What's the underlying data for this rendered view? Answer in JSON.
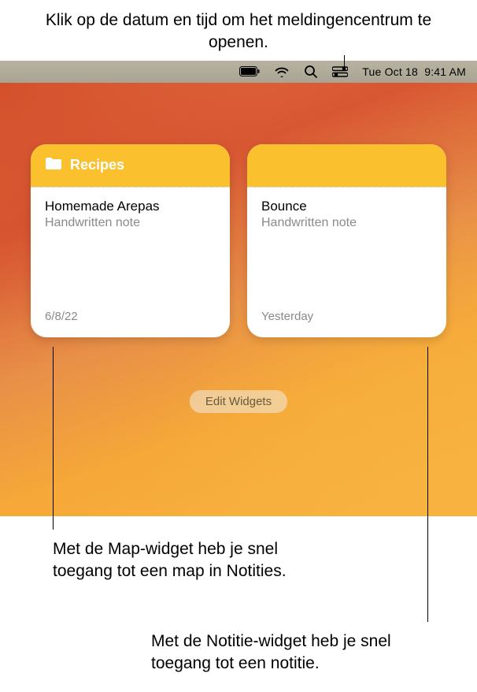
{
  "captions": {
    "top": "Klik op de datum en tijd om het meldingencentrum te openen.",
    "bottom_left": "Met de Map-widget heb je snel toegang tot een map in Notities.",
    "bottom_right": "Met de Notitie-widget heb je snel toegang tot een notitie."
  },
  "menubar": {
    "date": "Tue Oct 18",
    "time": "9:41 AM"
  },
  "widgets": {
    "folder_widget": {
      "title": "Recipes",
      "note_title": "Homemade Arepas",
      "note_subtitle": "Handwritten note",
      "date": "6/8/22"
    },
    "note_widget": {
      "note_title": "Bounce",
      "note_subtitle": "Handwritten note",
      "date": "Yesterday"
    }
  },
  "edit_button_label": "Edit Widgets",
  "colors": {
    "widget_accent": "#fbc02d"
  }
}
